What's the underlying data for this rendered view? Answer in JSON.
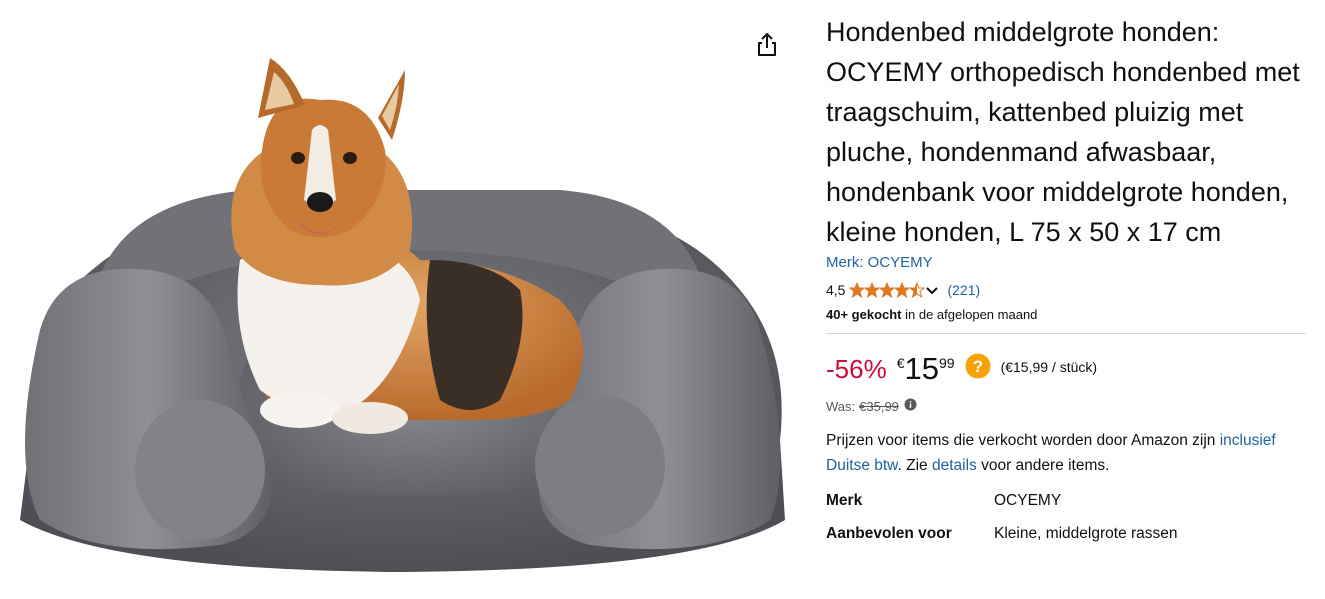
{
  "product": {
    "title": "Hondenbed middelgrote honden: OCYEMY orthopedisch hondenbed met traagschuim, kattenbed pluizig met pluche, hondenmand afwasbaar, hondenbank voor middelgrote honden, kleine honden, L 75 x 50 x 17 cm",
    "brand_link": "Merk: OCYEMY",
    "rating": "4,5",
    "rating_stars_value": 4.5,
    "review_count": "(221)",
    "bought_bold": "40+ gekocht",
    "bought_rest": " in de afgelopen maand"
  },
  "price": {
    "discount": "-56%",
    "currency": "€",
    "whole": "15",
    "fraction": "99",
    "unit_price": "(€15,99 / stück)",
    "was_label": "Was:",
    "was_price": "€35,99"
  },
  "note": {
    "text_before": "Prijzen voor items die verkocht worden door Amazon zijn ",
    "link1": "inclusief Duitse btw",
    "text_middle": ". Zie ",
    "link2": "details",
    "text_after": " voor andere items."
  },
  "specs": [
    {
      "label": "Merk",
      "value": "OCYEMY"
    },
    {
      "label": "Aanbevolen voor",
      "value": "Kleine, middelgrote rassen"
    }
  ],
  "icons": {
    "share": "share-icon",
    "help": "question-mark-icon",
    "info": "info-icon",
    "chevron": "chevron-down-icon"
  },
  "colors": {
    "star": "#de7921",
    "discount": "#cc0c39",
    "link": "#2162a1",
    "help": "#f7a200"
  }
}
